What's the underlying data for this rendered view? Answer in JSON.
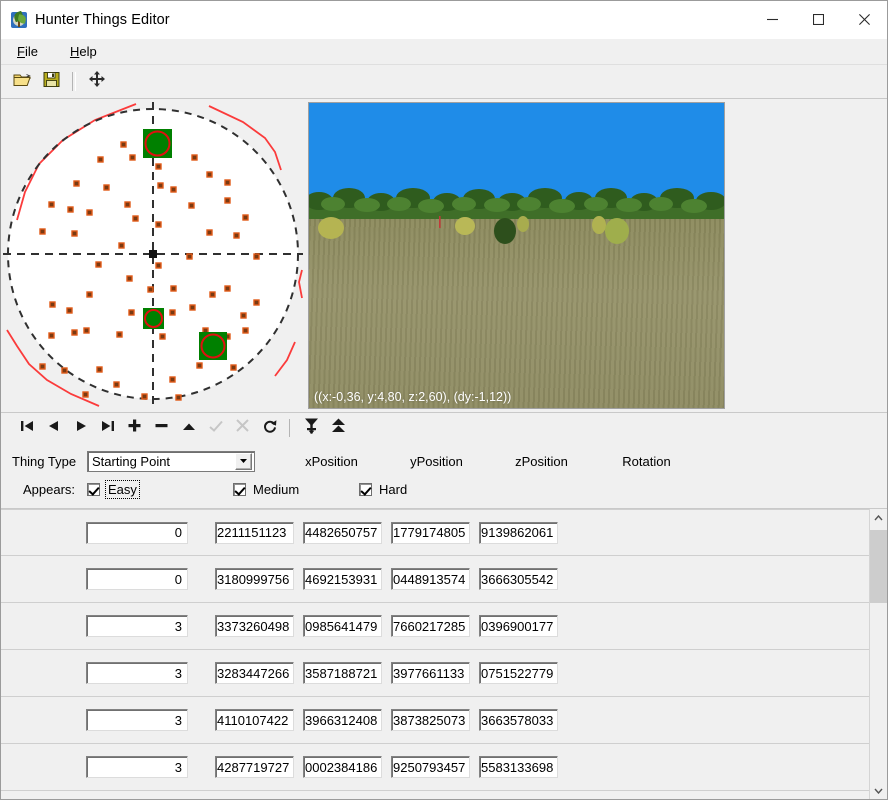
{
  "window": {
    "title": "Hunter Things Editor",
    "icon": "app-globe-tree-icon",
    "minimize_label": "—",
    "maximize_label": "□",
    "close_label": "✕"
  },
  "menu": {
    "items": [
      {
        "label": "File",
        "accel": "F"
      },
      {
        "label": "Help",
        "accel": "H"
      }
    ]
  },
  "toolbar": {
    "buttons": [
      {
        "name": "open-file-button",
        "icon": "open-folder-icon",
        "label": "Open"
      },
      {
        "name": "save-file-button",
        "icon": "save-floppy-icon",
        "label": "Save"
      },
      {
        "name": "move-tool-button",
        "icon": "move-four-arrows-icon",
        "label": "Move"
      }
    ]
  },
  "map": {
    "name": "map-preview",
    "circle_color": "#ffffff",
    "boundary_color": "#fb3b3b",
    "marker_fill": "#7a3a12",
    "marker_outline": "#e05a18",
    "selected_fill": "#008000",
    "selected_outline": "#e01010",
    "crosshair_color": "#333333"
  },
  "viewport": {
    "name": "3d-viewport",
    "status": "((x:-0,36, y:4,80, z:2,60), (dy:-1,12))",
    "sky_color": "#1f8ce8",
    "tree_color": "#3f6e28",
    "ground_color": "#8e8b61"
  },
  "navbar": {
    "buttons": [
      {
        "name": "first-record-button",
        "icon": "skip-to-first-icon",
        "enabled": true
      },
      {
        "name": "previous-record-button",
        "icon": "triangle-left-icon",
        "enabled": true
      },
      {
        "name": "next-record-button",
        "icon": "triangle-right-icon",
        "enabled": true
      },
      {
        "name": "last-record-button",
        "icon": "skip-to-last-icon",
        "enabled": true
      },
      {
        "name": "add-record-button",
        "icon": "plus-icon",
        "enabled": true
      },
      {
        "name": "delete-record-button",
        "icon": "minus-icon",
        "enabled": true
      },
      {
        "name": "edit-record-button",
        "icon": "triangle-up-icon",
        "enabled": true
      },
      {
        "name": "post-edit-button",
        "icon": "check-icon",
        "enabled": false
      },
      {
        "name": "cancel-edit-button",
        "icon": "x-cross-icon",
        "enabled": false
      },
      {
        "name": "refresh-button",
        "icon": "refresh-arrow-icon",
        "enabled": true
      },
      {
        "name": "drop-to-ground-button",
        "icon": "filter-down-arrow-icon",
        "enabled": true
      },
      {
        "name": "raise-up-button",
        "icon": "double-up-arrow-icon",
        "enabled": true
      }
    ]
  },
  "form": {
    "thing_type_label": "Thing Type",
    "thing_type_value": "Starting Point",
    "appears_label": "Appears:",
    "difficulties": [
      {
        "label": "Easy",
        "checked": true,
        "focused": true
      },
      {
        "label": "Medium",
        "checked": true,
        "focused": false
      },
      {
        "label": "Hard",
        "checked": true,
        "focused": false
      }
    ],
    "columns": [
      "xPosition",
      "yPosition",
      "zPosition",
      "Rotation"
    ]
  },
  "grid": {
    "rows": [
      {
        "index": "0",
        "xPosition": "2211151123",
        "yPosition": "4482650757",
        "zPosition": "1779174805",
        "rotation": "9139862061"
      },
      {
        "index": "0",
        "xPosition": "3180999756",
        "yPosition": "4692153931",
        "zPosition": "0448913574",
        "rotation": "3666305542"
      },
      {
        "index": "3",
        "xPosition": "3373260498",
        "yPosition": "0985641479",
        "zPosition": "7660217285",
        "rotation": "0396900177"
      },
      {
        "index": "3",
        "xPosition": "3283447266",
        "yPosition": "3587188721",
        "zPosition": "3977661133",
        "rotation": "0751522779"
      },
      {
        "index": "3",
        "xPosition": "4110107422",
        "yPosition": "3966312408",
        "zPosition": "3873825073",
        "rotation": "3663578033"
      },
      {
        "index": "3",
        "xPosition": "4287719727",
        "yPosition": "0002384186",
        "zPosition": "9250793457",
        "rotation": "5583133698"
      }
    ]
  },
  "scrollbar": {
    "up_label": "∧",
    "down_label": "∨"
  }
}
